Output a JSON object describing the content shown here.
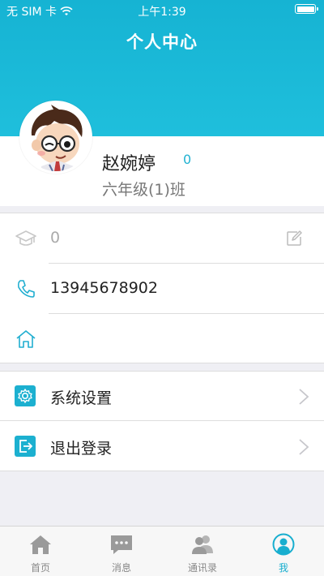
{
  "status_bar": {
    "carrier": "无 SIM 卡",
    "time": "上午1:39"
  },
  "header": {
    "title": "个人中心"
  },
  "profile": {
    "name": "赵婉婷",
    "points": "0",
    "class_name": "六年级(1)班"
  },
  "info": {
    "grade_value": "0",
    "phone": "13945678902",
    "address": ""
  },
  "menu": {
    "settings_label": "系统设置",
    "logout_label": "退出登录"
  },
  "tabs": [
    {
      "label": "首页",
      "icon": "home-icon"
    },
    {
      "label": "消息",
      "icon": "message-icon"
    },
    {
      "label": "通讯录",
      "icon": "contacts-icon"
    },
    {
      "label": "我",
      "icon": "me-icon"
    }
  ],
  "colors": {
    "accent": "#1fbfdc",
    "tab_active": "#17aecf"
  }
}
